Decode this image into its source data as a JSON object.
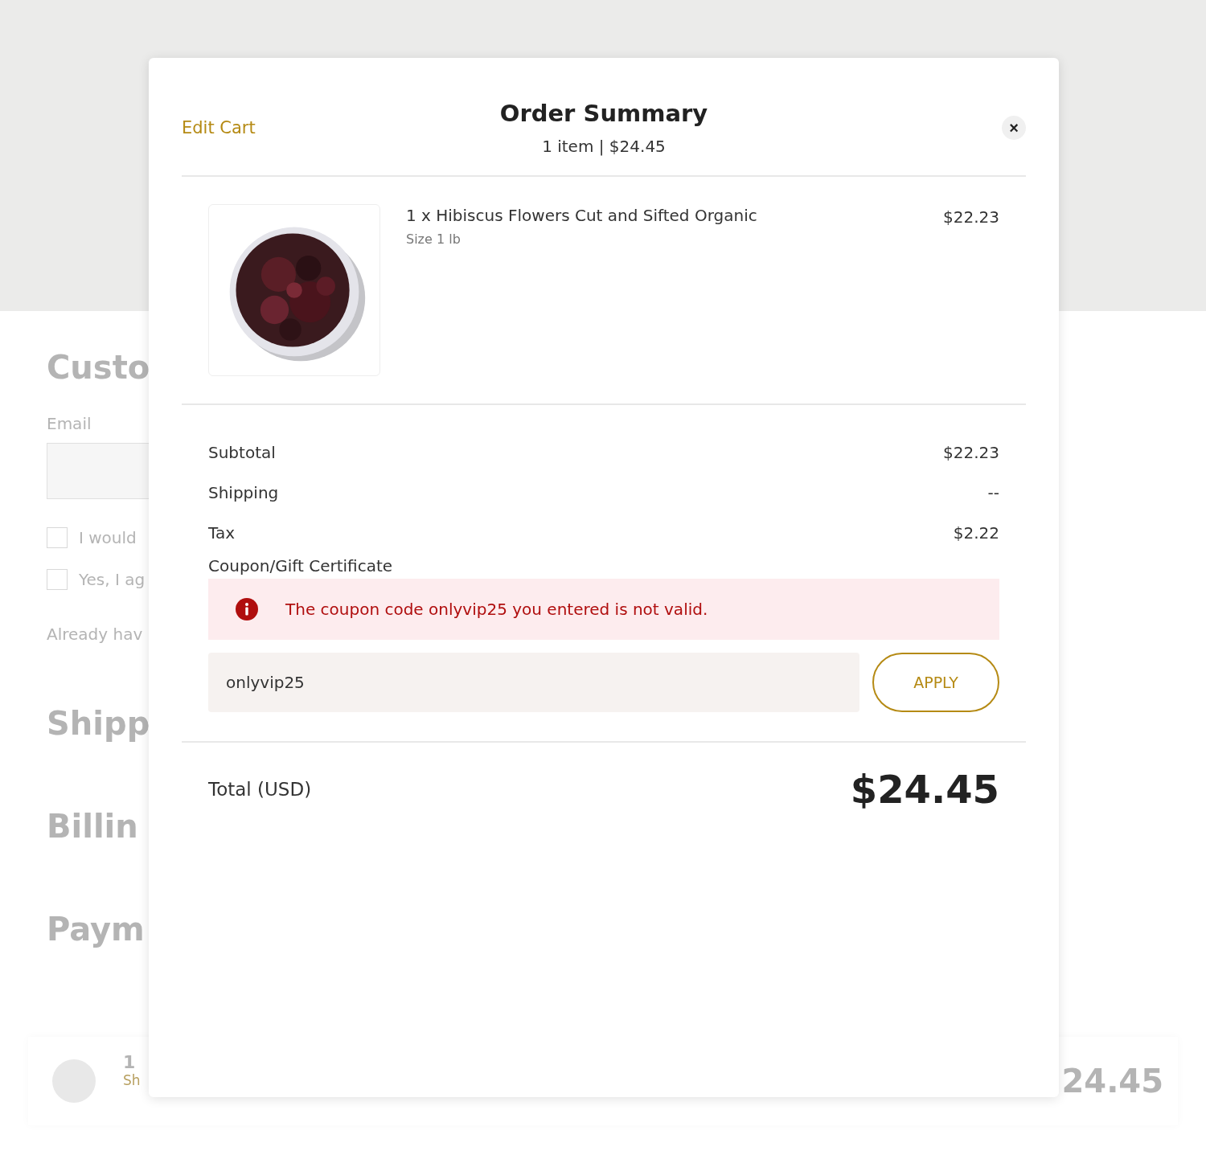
{
  "background": {
    "heading": "Custo",
    "email_label": "Email",
    "options": [
      {
        "label": "I would",
        "checked": false
      },
      {
        "label": "Yes, I ag",
        "checked": false
      }
    ],
    "login_prompt": "Already hav",
    "sections": [
      "Shipp",
      "Billin",
      "Paym"
    ],
    "summary_bar": {
      "count": "1",
      "details_link": "Sh",
      "total": "24.45"
    }
  },
  "modal": {
    "edit_link": "Edit Cart",
    "title": "Order Summary",
    "subtitle": "1 item | $24.45",
    "close": "×",
    "items": [
      {
        "name": "1 x Hibiscus Flowers Cut and Sifted Organic",
        "variant": "Size 1 lb",
        "price": "$22.23"
      }
    ],
    "totals": [
      {
        "label": "Subtotal",
        "value": "$22.23"
      },
      {
        "label": "Shipping",
        "value": "--"
      },
      {
        "label": "Tax",
        "value": "$2.22"
      }
    ],
    "coupon": {
      "label": "Coupon/Gift Certificate",
      "error": "The coupon code onlyvip25 you entered is not valid.",
      "value": "onlyvip25",
      "button": "APPLY"
    },
    "total": {
      "label": "Total (USD)",
      "value": "$24.45"
    }
  }
}
